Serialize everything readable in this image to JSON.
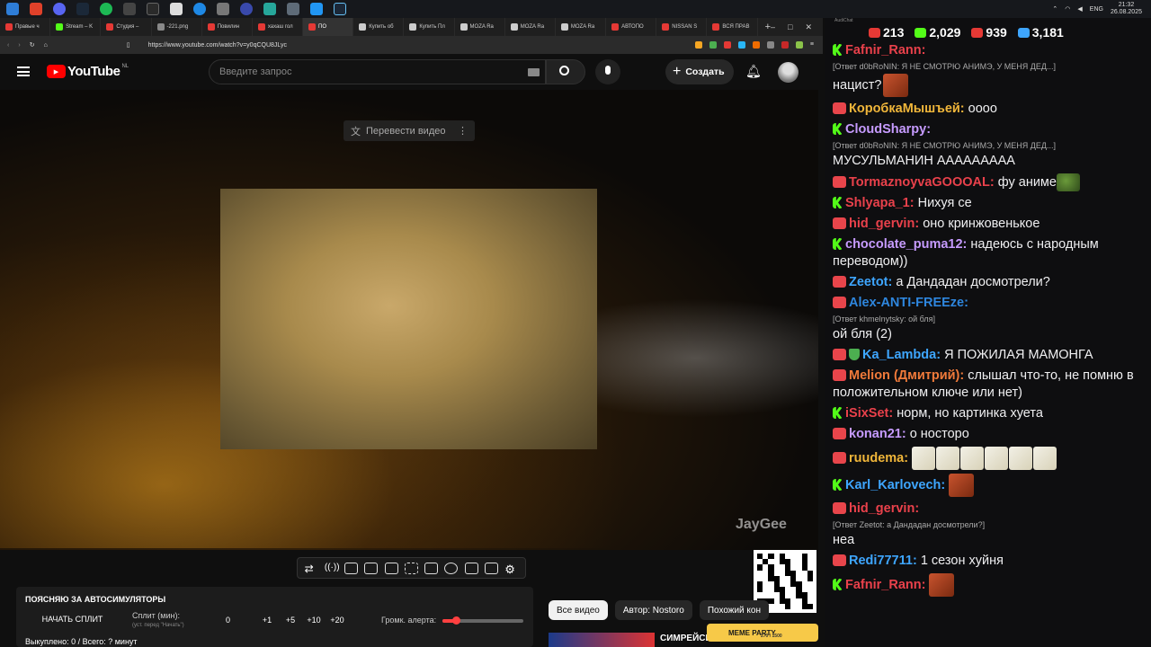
{
  "taskbar": {
    "lang": "ENG",
    "time": "21:32",
    "date": "26.08.2025"
  },
  "tabs": [
    {
      "label": "Правые ч",
      "color": "#e53935"
    },
    {
      "label": "Stream – K",
      "color": "#53fc18"
    },
    {
      "label": "Студия –",
      "color": "#e53935"
    },
    {
      "label": "-221.png",
      "color": "#888"
    },
    {
      "label": "Повилин",
      "color": "#e53935"
    },
    {
      "label": "хахаш гол",
      "color": "#e53935"
    },
    {
      "label": "ПО",
      "color": "#e53935",
      "active": true
    },
    {
      "label": "Купить об",
      "color": "#ccc"
    },
    {
      "label": "Купить Пл",
      "color": "#ccc"
    },
    {
      "label": "MOZA Ra",
      "color": "#ccc"
    },
    {
      "label": "MOZA Ra",
      "color": "#ccc"
    },
    {
      "label": "MOZA Ra",
      "color": "#ccc"
    },
    {
      "label": "АВТОПО",
      "color": "#e53935"
    },
    {
      "label": "NISSAN S",
      "color": "#e53935"
    },
    {
      "label": "ВСЯ ПРАВ",
      "color": "#e53935"
    }
  ],
  "address": {
    "url": "https://www.youtube.com/watch?v=y0qCQU8JLyc"
  },
  "yt": {
    "logo": "YouTube",
    "region": "NL",
    "search_placeholder": "Введите запрос",
    "create_label": "Создать",
    "translate_label": "Перевести видео",
    "watermark": "JayGee"
  },
  "panel": {
    "title": "ПОЯСНЯЮ ЗА АВТОСИМУЛЯТОРЫ",
    "start_button": "НАЧАТЬ СПЛИТ",
    "split_label": "Сплит (мин):",
    "split_hint": "(уст. перед \"Начать\")",
    "split_value": "0",
    "increments": [
      "+1",
      "+5",
      "+10",
      "+20"
    ],
    "volume_label": "Громк. алерта:",
    "volume_level": 0.17,
    "status": "Выкуплено: 0 / Всего: ? минут"
  },
  "chips": [
    "Все видео",
    "Автор: Nostoro",
    "Похожий кон"
  ],
  "rec_title": "СИМРЕЙСИ",
  "overlay": {
    "brand": "MEME PARTY",
    "progress": "270 / 1500"
  },
  "chat": {
    "app": "AudiChat",
    "stats": [
      {
        "icon": "youtube-live-icon",
        "value": "213",
        "color": "#e53935"
      },
      {
        "icon": "kick-icon",
        "value": "2,029",
        "color": "#53fc18"
      },
      {
        "icon": "live-badge-icon",
        "value": "939",
        "color": "#e53935"
      },
      {
        "icon": "viewers-icon",
        "value": "3,181",
        "color": "#3ea6ff"
      }
    ],
    "messages": [
      {
        "badge": "k",
        "user": "Fafnir_Rann:",
        "color": "#e9414b",
        "reply": "[Ответ d0bRoNIN: Я НЕ СМОТРЮ АНИМЭ, У МЕНЯ ДЕД...]",
        "text": "нацист?",
        "emote": "face"
      },
      {
        "badge": "live",
        "user": "КоробкаМышъей:",
        "color": "#f0b63a",
        "text": "оооо"
      },
      {
        "badge": "k",
        "user": "CloudSharpy:",
        "color": "#c69bff",
        "reply": "[Ответ d0bRoNIN: Я НЕ СМОТРЮ АНИМЭ, У МЕНЯ ДЕД...]",
        "text": "МУСУЛЬМАНИН ААААААААА"
      },
      {
        "badge": "live",
        "user": "TormaznoyvaGOOOAL:",
        "color": "#e9414b",
        "text": "фу аниме",
        "emote": "pepe"
      },
      {
        "badge": "k",
        "user": "Shlyapa_1:",
        "color": "#e9414b",
        "text": "Нихуя се"
      },
      {
        "badge": "live",
        "user": "hid_gervin:",
        "color": "#e9414b",
        "text": "оно кринжовенькое"
      },
      {
        "badge": "k",
        "user": "chocolate_puma12:",
        "color": "#c69bff",
        "text": "надеюсь с народным переводом))"
      },
      {
        "badge": "live",
        "user": "Zeetot:",
        "color": "#3ea6ff",
        "text": "а Дандадан досмотрели?"
      },
      {
        "badge": "live",
        "user": "Alex-ANTI-FREEze:",
        "color": "#2e86de",
        "reply": "[Ответ khmelnytsky: ой бля]",
        "text": "ой бля (2)"
      },
      {
        "badge": "live",
        "user": "Ka_Lambda:",
        "color": "#3ea6ff",
        "text": "Я ПОЖИЛАЯ МАМОНГА",
        "shield": true
      },
      {
        "badge": "live",
        "user": "Melion (Дмитрий):",
        "color": "#f07a3a",
        "text": "слышал что-то, не помню в положительном ключе или нет)"
      },
      {
        "badge": "k",
        "user": "iSixSet:",
        "color": "#e9414b",
        "text": "норм, но картинка хуета"
      },
      {
        "badge": "live",
        "user": "konan21:",
        "color": "#c69bff",
        "text": "о носторо"
      },
      {
        "badge": "live",
        "user": "ruudema:",
        "color": "#f0b63a",
        "text": "",
        "emote": "white6"
      },
      {
        "badge": "k",
        "user": "Karl_Karlovech:",
        "color": "#3ea6ff",
        "text": "",
        "emote": "face"
      },
      {
        "badge": "live",
        "user": "hid_gervin:",
        "color": "#e9414b",
        "reply": "[Ответ Zeetot: а Дандадан досмотрели?]",
        "text": "неа"
      },
      {
        "badge": "live",
        "user": "Redi77711:",
        "color": "#3ea6ff",
        "text": "1 сезон хуйня"
      },
      {
        "badge": "k",
        "user": "Fafnir_Rann:",
        "color": "#e9414b",
        "text": "",
        "emote": "face"
      }
    ]
  }
}
